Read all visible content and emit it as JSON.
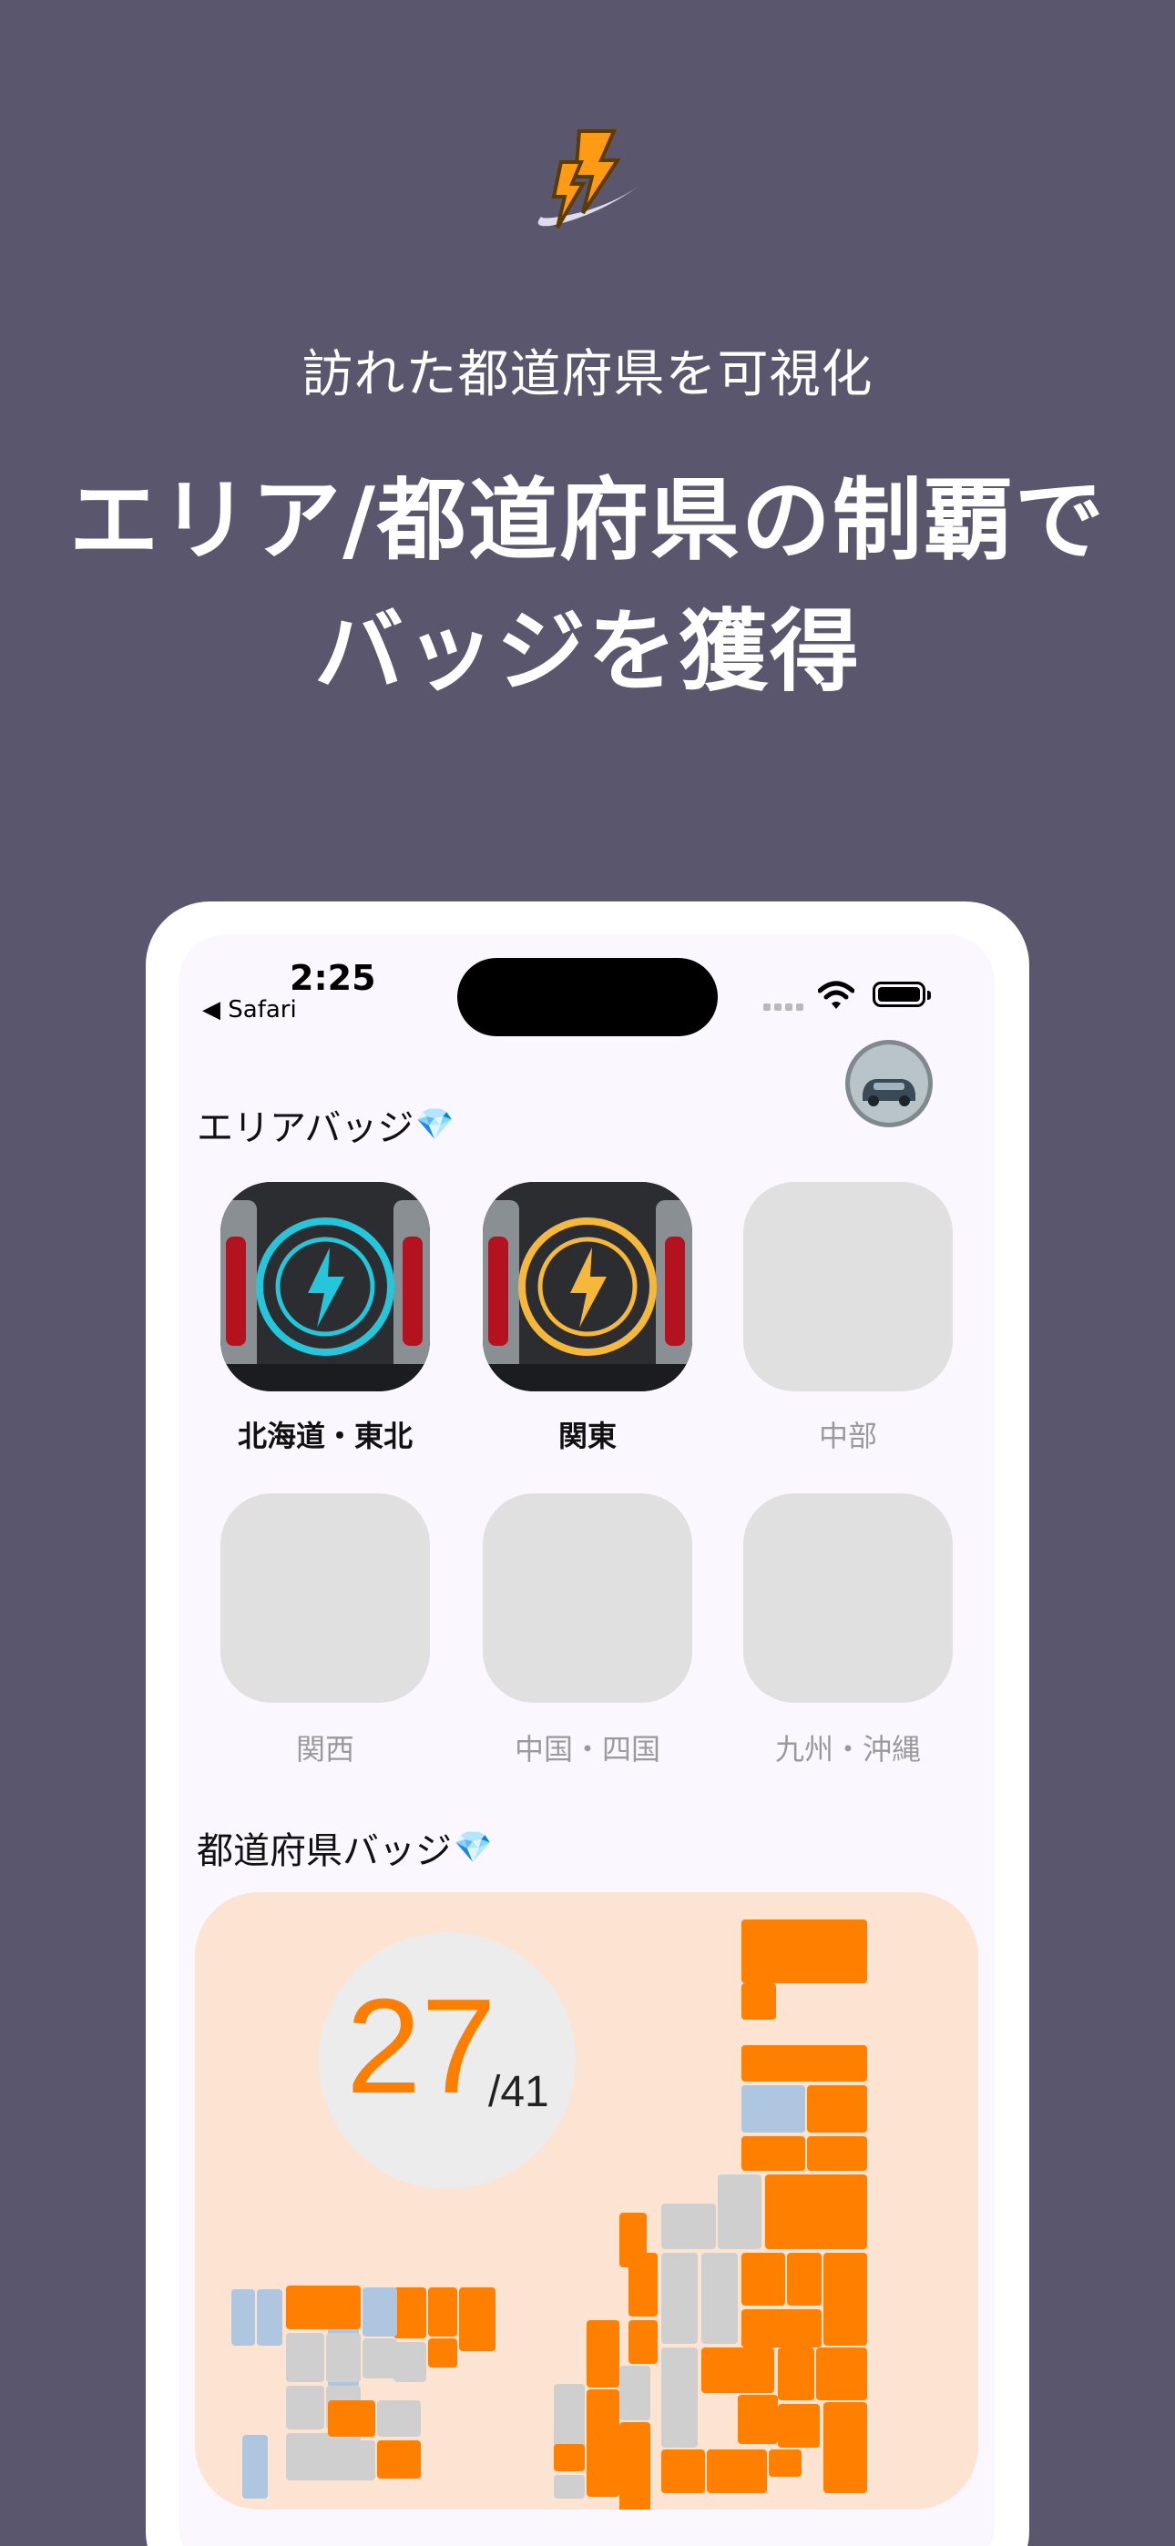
{
  "header": {
    "subtitle": "訪れた都道府県を可視化",
    "headline_line1": "エリア/都道府県の制覇で",
    "headline_line2": "バッジを獲得"
  },
  "status_bar": {
    "time": "2:25",
    "back_app": "◀ Safari"
  },
  "area_section": {
    "title": "エリアバッジ",
    "gem": "💎",
    "badges": [
      {
        "label": "北海道・東北",
        "earned": true,
        "color": "#26c6da"
      },
      {
        "label": "関東",
        "earned": true,
        "color": "#f5b83a"
      },
      {
        "label": "中部",
        "earned": false
      },
      {
        "label": "関西",
        "earned": false
      },
      {
        "label": "中国・四国",
        "earned": false
      },
      {
        "label": "九州・沖縄",
        "earned": false
      }
    ]
  },
  "prefecture_section": {
    "title": "都道府県バッジ",
    "gem": "💎",
    "count": "27",
    "total": "/41"
  },
  "colors": {
    "background": "#59566e",
    "visited": "#ff8000",
    "unvisited": "#cfcfcf",
    "planned": "#aec6df",
    "card": "#fde4d2"
  },
  "tab_icons": [
    "map-icon",
    "badge-icon",
    "car-icon",
    "sparkles-icon"
  ]
}
